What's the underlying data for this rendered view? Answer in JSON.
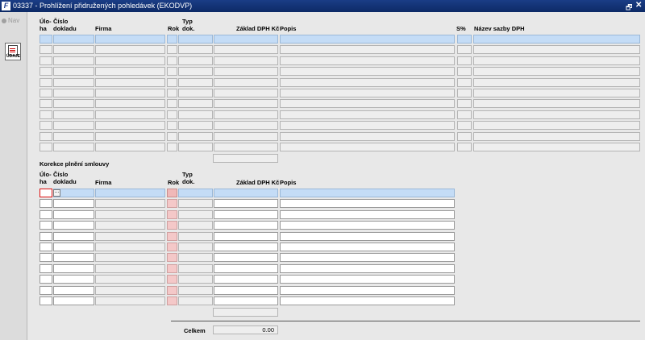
{
  "window": {
    "title": "03337 - Prohlížení přidružených pohledávek (EKODVP)",
    "app_icon": "F",
    "restore_glyph": "🗗",
    "close_glyph": "✕"
  },
  "nav": {
    "label": "Nav",
    "udaje_button_label": "ÚDAJE"
  },
  "top_block": {
    "headers": {
      "uloha": "Úlo-\nha",
      "cislo_dokladu": "Číslo\ndokladu",
      "firma": "Firma",
      "rok": "Rok",
      "typ_dok": "Typ\ndok.",
      "zaklad_dph": "Základ DPH Kč",
      "popis": "Popis",
      "s_pct": "S%",
      "nazev_sazby": "Název sazby DPH"
    },
    "rows": 11
  },
  "bottom_block": {
    "section_title": "Korekce plnění smlouvy",
    "headers": {
      "uloha": "Úlo-\nha",
      "cislo_dokladu": "Číslo\ndokladu",
      "firma": "Firma",
      "rok": "Rok",
      "typ_dok": "Typ\ndok.",
      "zaklad_dph": "Základ DPH Kč",
      "popis": "Popis"
    },
    "rows": 11,
    "lov_label": "..."
  },
  "total": {
    "label": "Celkem",
    "value": "0.00"
  }
}
